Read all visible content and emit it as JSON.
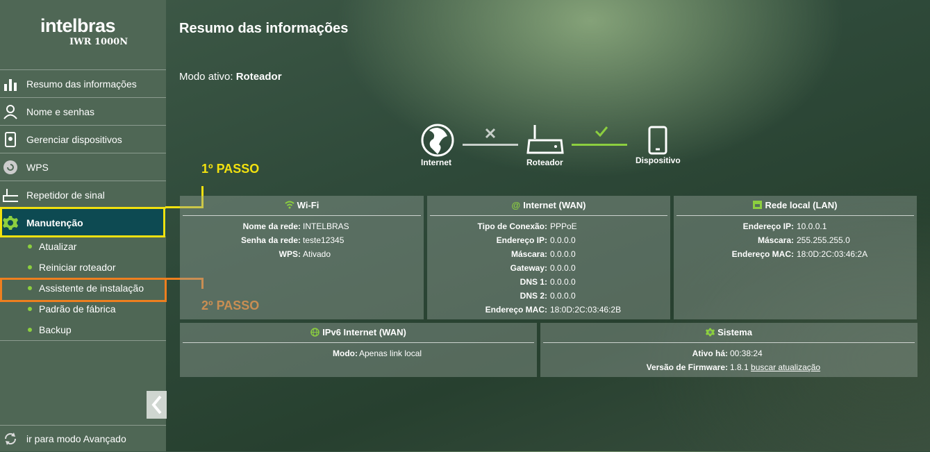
{
  "brand": {
    "logo": "intelbras",
    "model": "IWR 1000N"
  },
  "sidebar": {
    "items": [
      {
        "label": "Resumo das informações",
        "icon": "bar-chart-icon"
      },
      {
        "label": "Nome e senhas",
        "icon": "user-icon"
      },
      {
        "label": "Gerenciar dispositivos",
        "icon": "device-icon"
      },
      {
        "label": "WPS",
        "icon": "wps-icon"
      },
      {
        "label": "Repetidor de sinal",
        "icon": "router-icon"
      },
      {
        "label": "Manutenção",
        "icon": "gear-icon"
      }
    ],
    "sub_items": [
      "Atualizar",
      "Reiniciar roteador",
      "Assistente de instalação",
      "Padrão de fábrica",
      "Backup"
    ],
    "advanced_label": "ir para modo Avançado"
  },
  "annotations": {
    "step1": "1º PASSO",
    "step2": "2º PASSO"
  },
  "main": {
    "title": "Resumo das informações",
    "mode_label": "Modo ativo:",
    "mode_value": "Roteador",
    "topology": {
      "internet": "Internet",
      "router": "Roteador",
      "device": "Dispositivo"
    }
  },
  "wifi": {
    "title": "Wi-Fi",
    "rows": [
      {
        "label": "Nome da rede:",
        "value": "INTELBRAS"
      },
      {
        "label": "Senha da rede:",
        "value": "teste12345"
      },
      {
        "label": "WPS:",
        "value": "Ativado"
      }
    ]
  },
  "wan": {
    "title": "Internet (WAN)",
    "rows": [
      {
        "label": "Tipo de Conexão:",
        "value": "PPPoE"
      },
      {
        "label": "Endereço IP:",
        "value": "0.0.0.0"
      },
      {
        "label": "Máscara:",
        "value": "0.0.0.0"
      },
      {
        "label": "Gateway:",
        "value": "0.0.0.0"
      },
      {
        "label": "DNS 1:",
        "value": "0.0.0.0"
      },
      {
        "label": "DNS 2:",
        "value": "0.0.0.0"
      },
      {
        "label": "Endereço MAC:",
        "value": "18:0D:2C:03:46:2B"
      }
    ]
  },
  "lan": {
    "title": "Rede local (LAN)",
    "rows": [
      {
        "label": "Endereço IP:",
        "value": "10.0.0.1"
      },
      {
        "label": "Máscara:",
        "value": "255.255.255.0"
      },
      {
        "label": "Endereço MAC:",
        "value": "18:0D:2C:03:46:2A"
      }
    ]
  },
  "ipv6": {
    "title": "IPv6 Internet (WAN)",
    "rows": [
      {
        "label": "Modo:",
        "value": "Apenas link local"
      }
    ]
  },
  "system": {
    "title": "Sistema",
    "uptime_label": "Ativo há:",
    "uptime_value": "00:38:24",
    "fw_label": "Versão de Firmware:",
    "fw_value": "1.8.1",
    "fw_link": "buscar atualização"
  },
  "colors": {
    "accent_green": "#8ccf3f",
    "active_bg": "#0d4a52",
    "step1": "#f2e10f",
    "step2": "#ee7f1f"
  }
}
